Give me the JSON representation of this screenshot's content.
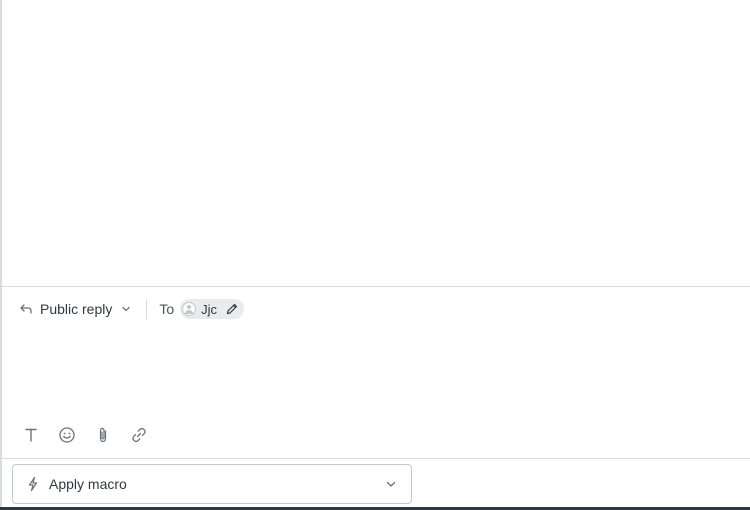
{
  "reply_bar": {
    "reply_type_label": "Public reply",
    "to_label": "To",
    "recipient_name": "Jjc"
  },
  "composer": {
    "placeholder": ""
  },
  "toolbar": {
    "icons": [
      "text-format-icon",
      "emoji-icon",
      "attachment-icon",
      "link-icon"
    ]
  },
  "macro": {
    "label": "Apply macro"
  },
  "colors": {
    "text": "#2f3941",
    "border": "#d8dcde",
    "icon": "#68737d",
    "pill": "#e9ebed"
  }
}
